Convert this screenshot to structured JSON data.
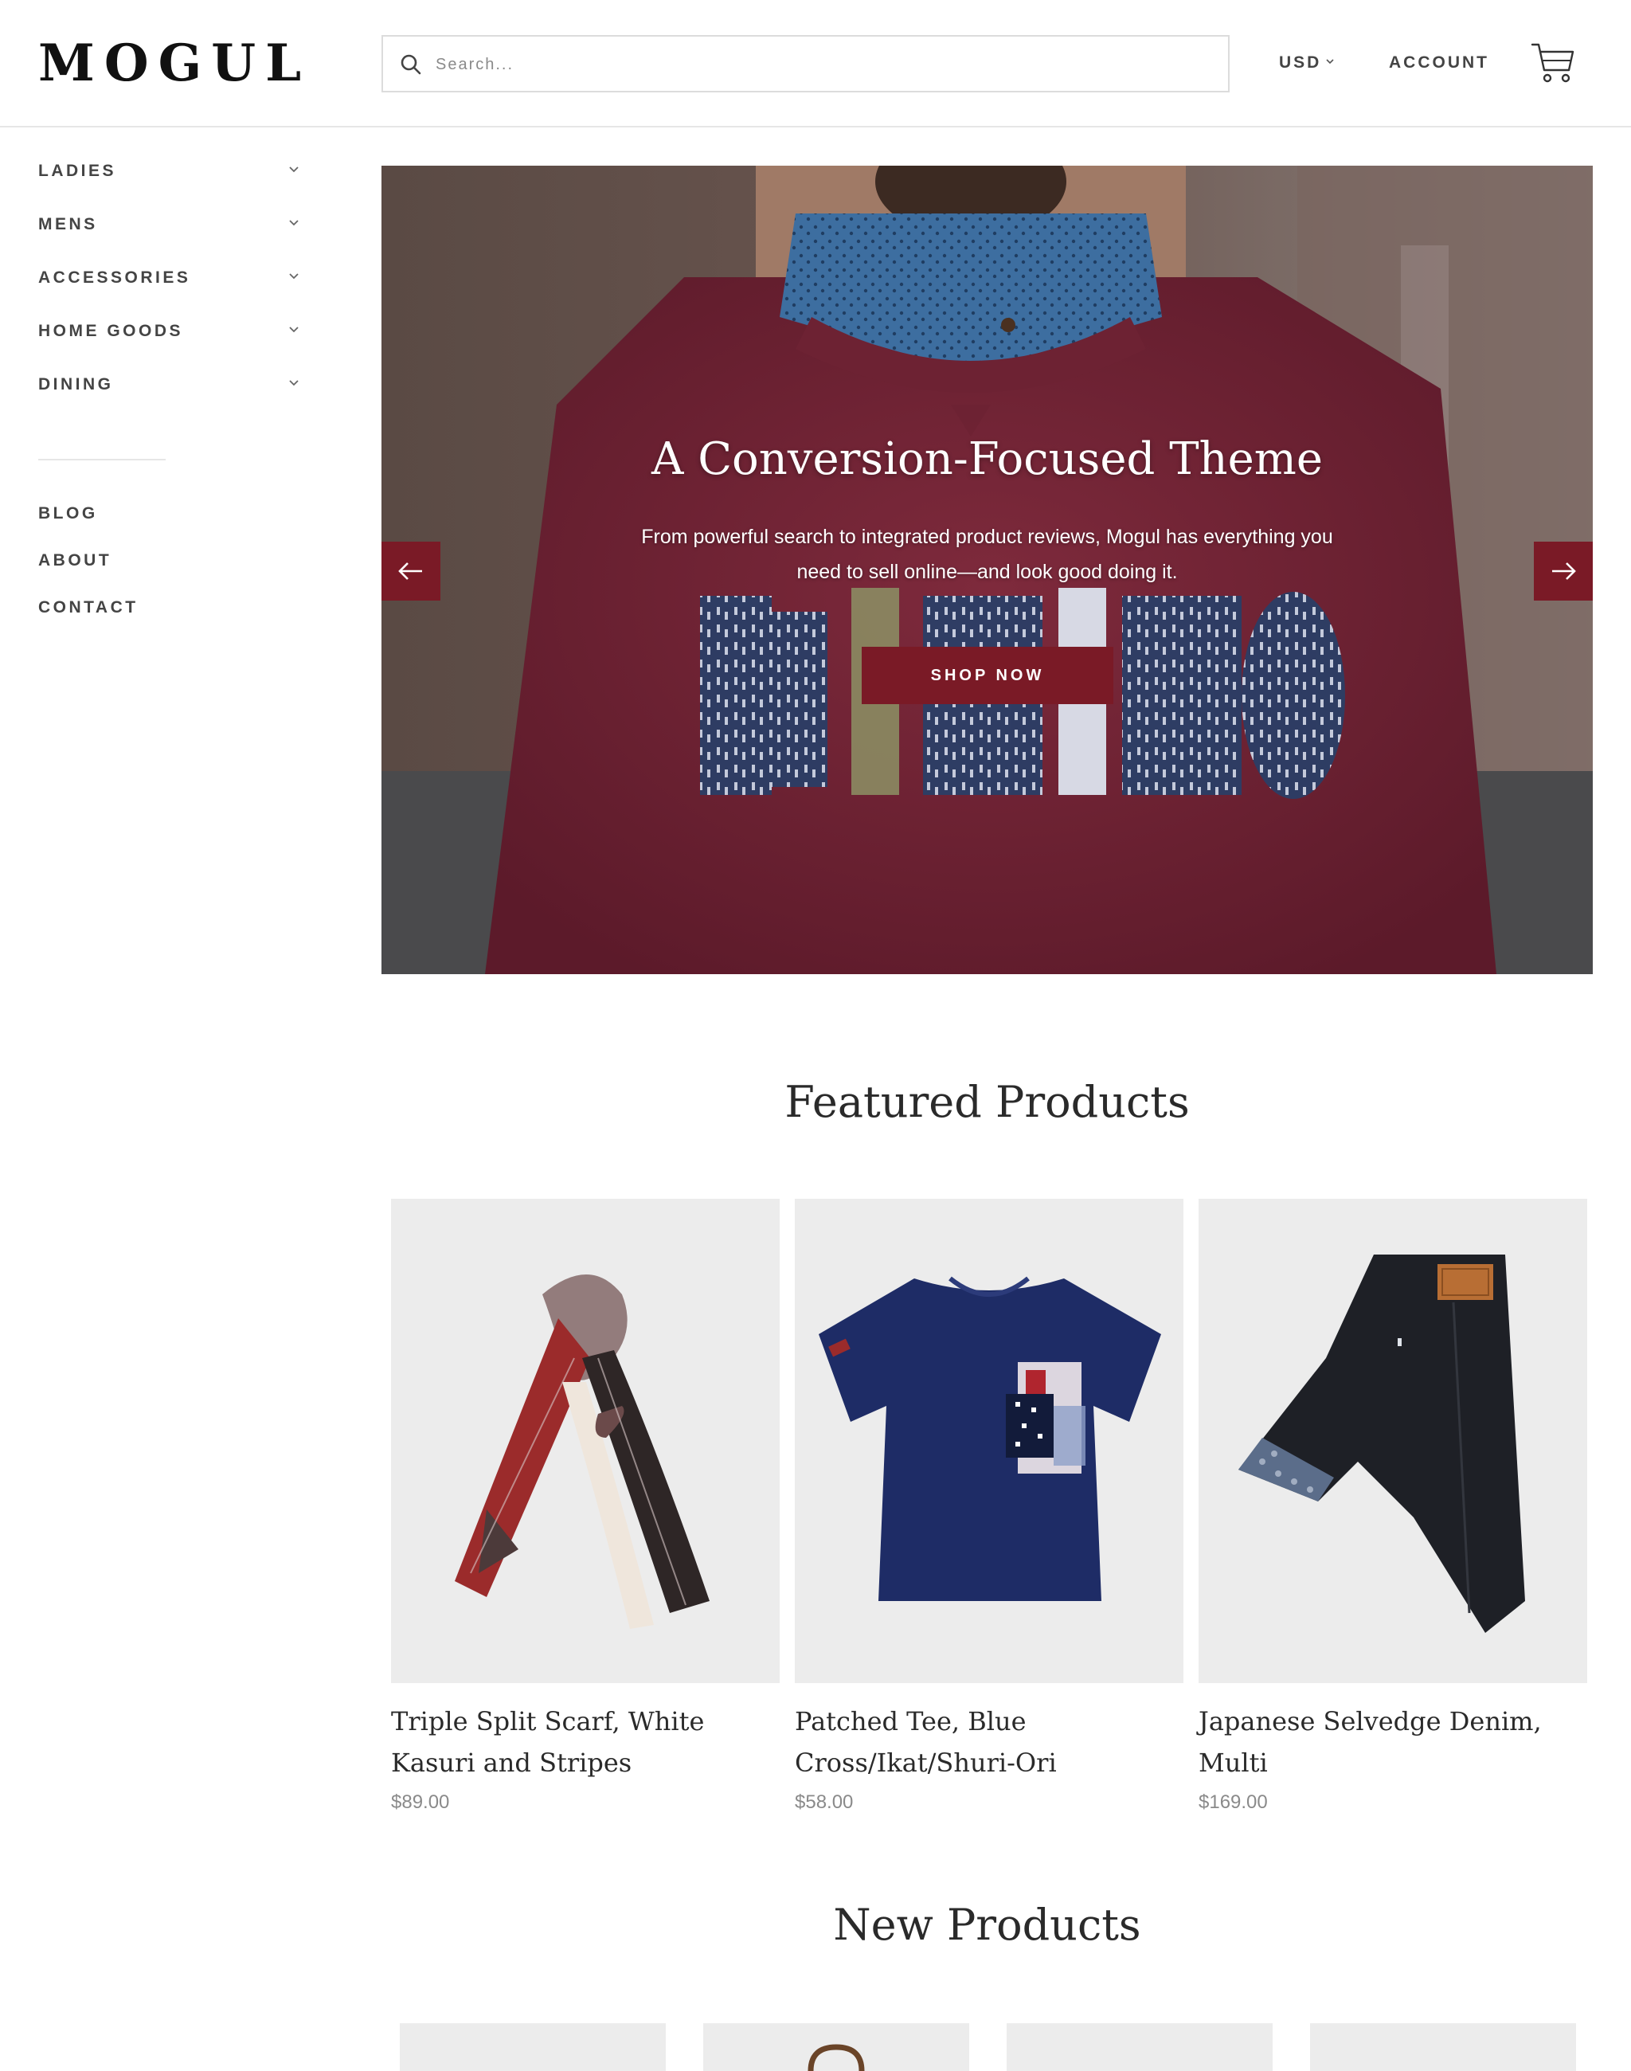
{
  "brand": {
    "logo": "MOGUL"
  },
  "header": {
    "search_placeholder": "Search...",
    "currency": "USD",
    "account": "ACCOUNT"
  },
  "sidebar": {
    "menu": [
      {
        "label": "LADIES"
      },
      {
        "label": "MENS"
      },
      {
        "label": "ACCESSORIES"
      },
      {
        "label": "HOME GOODS"
      },
      {
        "label": "DINING"
      }
    ],
    "links": [
      {
        "label": "BLOG"
      },
      {
        "label": "ABOUT"
      },
      {
        "label": "CONTACT"
      }
    ]
  },
  "hero": {
    "title": "A Conversion-Focused Theme",
    "text": "From powerful search to integrated product reviews, Mogul has everything you need to sell online—and look good doing it.",
    "cta": "SHOP NOW",
    "sweater_text": "KIRIKO"
  },
  "featured": {
    "title": "Featured Products",
    "products": [
      {
        "title": "Triple Split Scarf, White Kasuri and Stripes",
        "price": "$89.00",
        "icon": "scarf-image"
      },
      {
        "title": "Patched Tee, Blue Cross/Ikat/Shuri-Ori",
        "price": "$58.00",
        "icon": "tee-image"
      },
      {
        "title": "Japanese Selvedge Denim, Multi",
        "price": "$169.00",
        "icon": "denim-image"
      }
    ]
  },
  "new_products": {
    "title": "New Products"
  },
  "colors": {
    "accent": "#7a1a26",
    "card_bg": "#ececec",
    "text": "#444444"
  }
}
